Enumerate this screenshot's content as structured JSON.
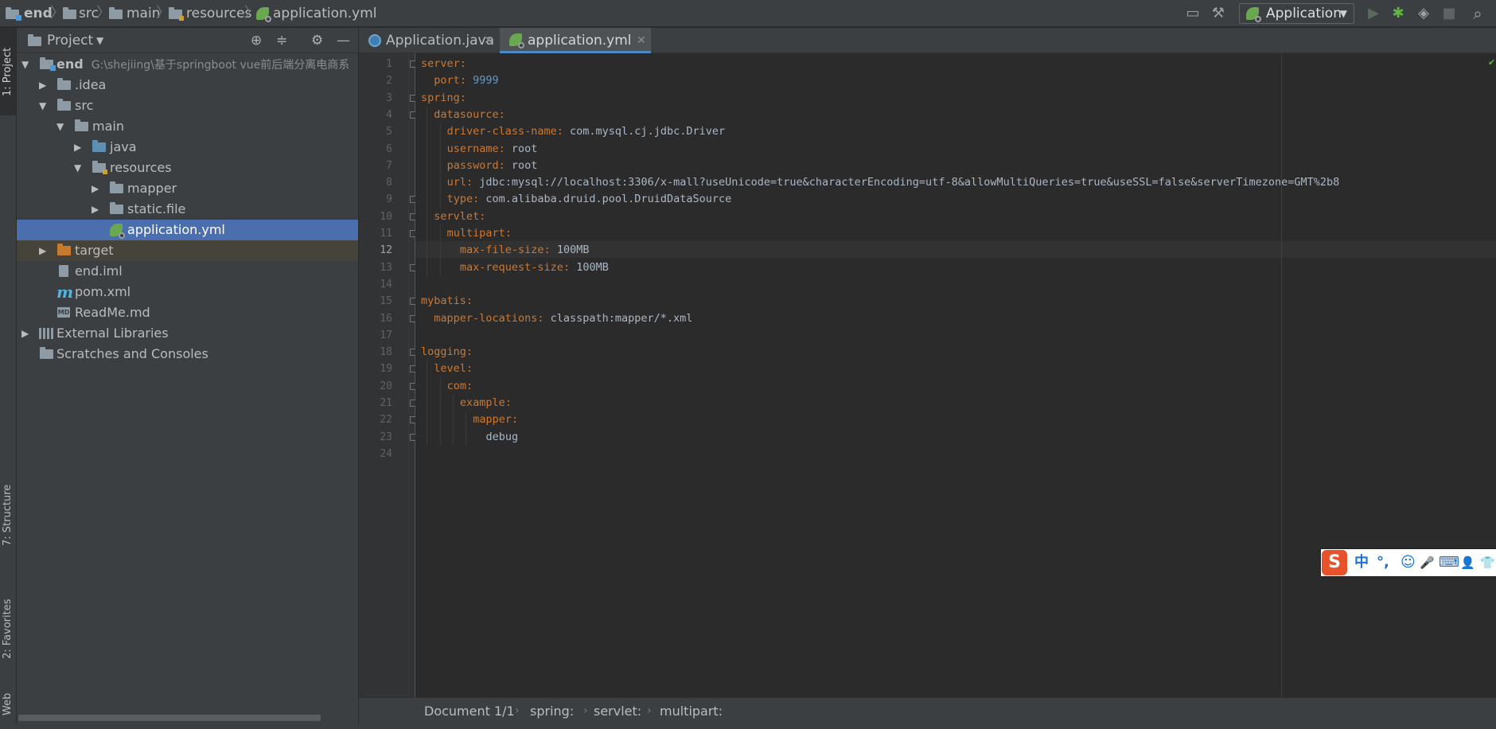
{
  "breadcrumb": [
    "end",
    "src",
    "main",
    "resources",
    "application.yml"
  ],
  "run_config": {
    "label": "Application"
  },
  "left_tool_tabs": [
    "1: Project",
    "7: Structure",
    "2: Favorites",
    "Web"
  ],
  "project_panel": {
    "title": "Project",
    "tree": [
      {
        "label": "end",
        "path": "G:\\shejiing\\基于springboot vue前后端分离电商系"
      },
      {
        "label": ".idea"
      },
      {
        "label": "src"
      },
      {
        "label": "main"
      },
      {
        "label": "java"
      },
      {
        "label": "resources"
      },
      {
        "label": "mapper"
      },
      {
        "label": "static.file"
      },
      {
        "label": "application.yml"
      },
      {
        "label": "target"
      },
      {
        "label": "end.iml"
      },
      {
        "label": "pom.xml"
      },
      {
        "label": "ReadMe.md"
      },
      {
        "label": "External Libraries"
      },
      {
        "label": "Scratches and Consoles"
      }
    ]
  },
  "tabs": [
    {
      "label": "Application.java"
    },
    {
      "label": "application.yml"
    }
  ],
  "editor": {
    "current_line": 12,
    "lines": [
      {
        "n": "1",
        "key": "server",
        "val": ""
      },
      {
        "n": "2",
        "key": "port",
        "val": "9999"
      },
      {
        "n": "3",
        "key": "spring",
        "val": ""
      },
      {
        "n": "4",
        "key": "datasource",
        "val": ""
      },
      {
        "n": "5",
        "key": "driver-class-name",
        "val": "com.mysql.cj.jdbc.Driver"
      },
      {
        "n": "6",
        "key": "username",
        "val": "root"
      },
      {
        "n": "7",
        "key": "password",
        "val": "root"
      },
      {
        "n": "8",
        "key": "url",
        "val": "jdbc:mysql://localhost:3306/x-mall?useUnicode=true&characterEncoding=utf-8&allowMultiQueries=true&useSSL=false&serverTimezone=GMT%2b8"
      },
      {
        "n": "9",
        "key": "type",
        "val": "com.alibaba.druid.pool.DruidDataSource"
      },
      {
        "n": "10",
        "key": "servlet",
        "val": ""
      },
      {
        "n": "11",
        "key": "multipart",
        "val": ""
      },
      {
        "n": "12",
        "key": "max-file-size",
        "val": "100MB"
      },
      {
        "n": "13",
        "key": "max-request-size",
        "val": "100MB"
      },
      {
        "n": "14",
        "key": "",
        "val": ""
      },
      {
        "n": "15",
        "key": "mybatis",
        "val": ""
      },
      {
        "n": "16",
        "key": "mapper-locations",
        "val": "classpath:mapper/*.xml"
      },
      {
        "n": "17",
        "key": "",
        "val": ""
      },
      {
        "n": "18",
        "key": "logging",
        "val": ""
      },
      {
        "n": "19",
        "key": "level",
        "val": ""
      },
      {
        "n": "20",
        "key": "com",
        "val": ""
      },
      {
        "n": "21",
        "key": "example",
        "val": ""
      },
      {
        "n": "22",
        "key": "mapper",
        "val": ""
      },
      {
        "n": "23",
        "key": "",
        "val": "debug"
      },
      {
        "n": "24",
        "key": "",
        "val": ""
      }
    ]
  },
  "editor_breadcrumb": [
    "Document 1/1",
    "spring:",
    "servlet:",
    "multipart:"
  ],
  "ime_toolbar": {
    "logo": "S",
    "items": [
      "中",
      "°,",
      "☺",
      "🎤",
      "⌨",
      "👤",
      "👕"
    ]
  },
  "colors": {
    "accent": "#4a88c7",
    "selection": "#4b6eaf",
    "keyword": "#cc7832",
    "number": "#6897bb"
  }
}
